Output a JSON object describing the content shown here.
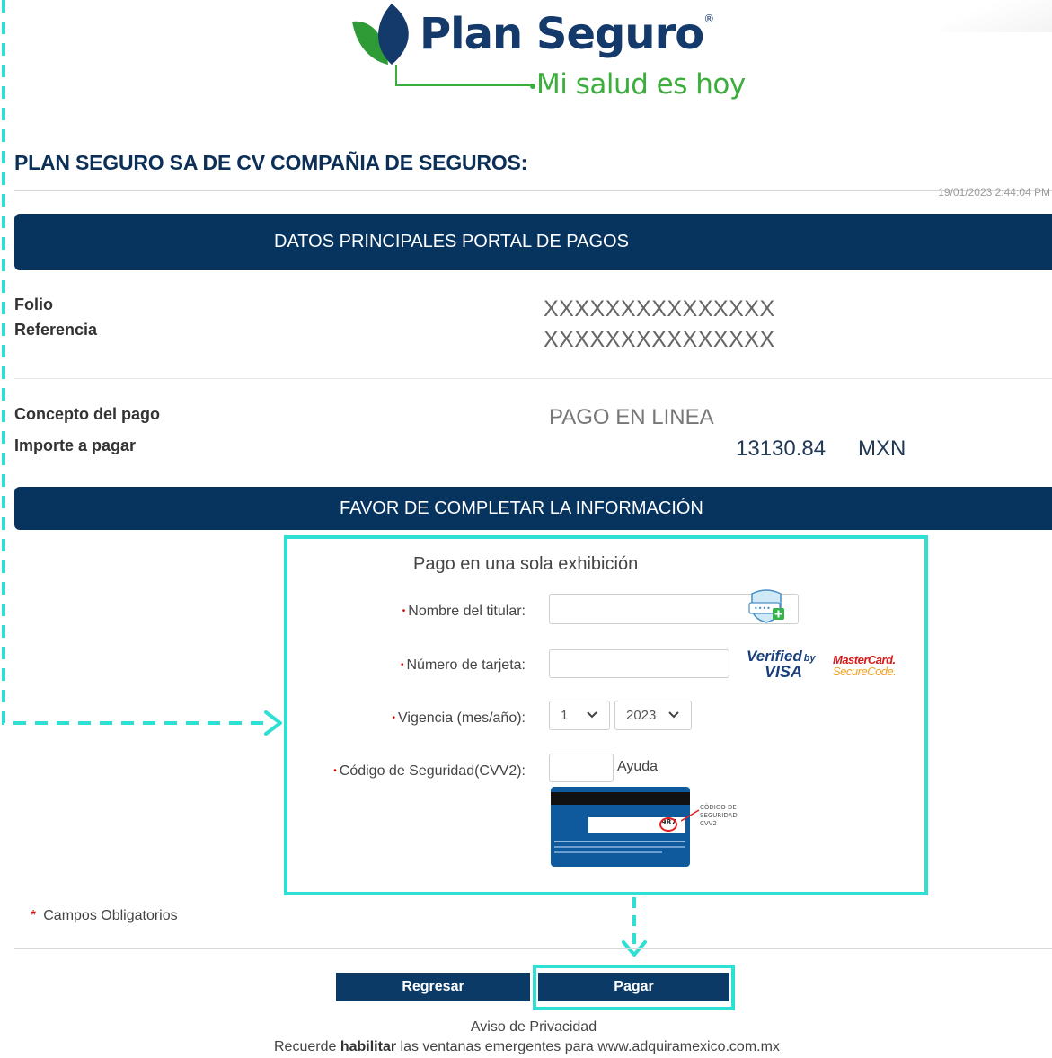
{
  "brand": {
    "name": "Plan Seguro",
    "registered": "®",
    "tagline": "Mi salud es hoy",
    "colors": {
      "navy": "#143a6b",
      "green": "#3cae3c",
      "highlight": "#2de0d3",
      "band": "#07335f"
    }
  },
  "header": {
    "company": "PLAN SEGURO SA DE CV COMPAÑIA DE SEGUROS:",
    "timestamp": "19/01/2023 2:44:04 PM"
  },
  "main_band": "DATOS PRINCIPALES PORTAL DE PAGOS",
  "details": {
    "folio_label": "Folio",
    "folio_value": "XXXXXXXXXXXXXXX",
    "referencia_label": "Referencia",
    "referencia_value": "XXXXXXXXXXXXXXX",
    "concepto_label": "Concepto del pago",
    "concepto_value": "PAGO EN LINEA",
    "importe_label": "Importe a pagar",
    "importe_value": "13130.84",
    "currency": "MXN"
  },
  "form_band": "FAVOR DE COMPLETAR LA INFORMACIÓN",
  "form": {
    "title": "Pago en una sola exhibición",
    "required_mark": "•",
    "name_label": "Nombre del titular:",
    "card_label": "Número de tarjeta:",
    "expiry_label": "Vigencia (mes/año):",
    "cvv_label": "Código de Seguridad(CVV2):",
    "month_value": "1",
    "year_value": "2023",
    "help_link": "Ayuda",
    "visa_verified_line1": "Verified",
    "visa_verified_by": "by",
    "visa_verified_line2": "VISA",
    "mastercard_line1": "MasterCard.",
    "mastercard_line2": "SecureCode.",
    "cvv_callout": [
      "CÓDIGO DE",
      "SEGURIDAD",
      "CVV2"
    ],
    "card_sample_code": "987"
  },
  "required_note": {
    "asterisk": "*",
    "text": "Campos Obligatorios"
  },
  "buttons": {
    "back": "Regresar",
    "pay": "Pagar"
  },
  "footer": {
    "privacy": "Aviso de Privacidad",
    "reminder_pre": "Recuerde ",
    "reminder_bold": "habilitar",
    "reminder_post": " las ventanas emergentes para www.adquiramexico.com.mx"
  }
}
